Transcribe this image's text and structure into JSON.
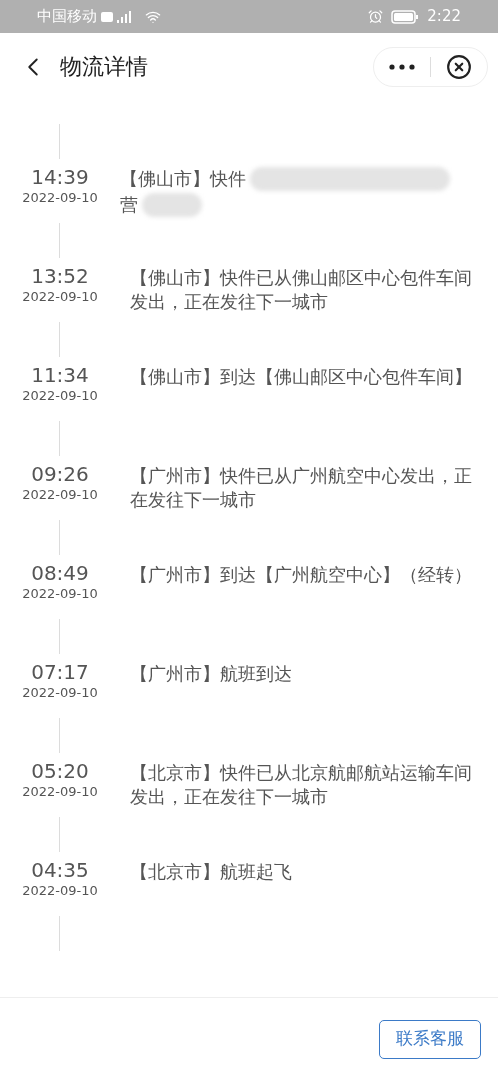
{
  "status_bar": {
    "carrier": "中国移动",
    "time": "2:22"
  },
  "header": {
    "title": "物流详情"
  },
  "events": [
    {
      "time": "14:39",
      "date": "2022-09-10",
      "redacted": true,
      "text_parts": [
        "【佛山市】快件",
        "营"
      ]
    },
    {
      "time": "13:52",
      "date": "2022-09-10",
      "redacted": false,
      "text_parts": [
        "【佛山市】快件已从佛山邮区中心包件车间发出，正在发往下一城市"
      ]
    },
    {
      "time": "11:34",
      "date": "2022-09-10",
      "redacted": false,
      "text_parts": [
        "【佛山市】到达【佛山邮区中心包件车间】"
      ]
    },
    {
      "time": "09:26",
      "date": "2022-09-10",
      "redacted": false,
      "text_parts": [
        "【广州市】快件已从广州航空中心发出，正在发往下一城市"
      ]
    },
    {
      "time": "08:49",
      "date": "2022-09-10",
      "redacted": false,
      "text_parts": [
        "【广州市】到达【广州航空中心】（经转）"
      ]
    },
    {
      "time": "07:17",
      "date": "2022-09-10",
      "redacted": false,
      "text_parts": [
        "【广州市】航班到达"
      ]
    },
    {
      "time": "05:20",
      "date": "2022-09-10",
      "redacted": false,
      "text_parts": [
        "【北京市】快件已从北京航邮航站运输车间发出，正在发往下一城市"
      ]
    },
    {
      "time": "04:35",
      "date": "2022-09-10",
      "redacted": false,
      "text_parts": [
        "【北京市】航班起飞"
      ]
    }
  ],
  "footer": {
    "button": "联系客服"
  }
}
